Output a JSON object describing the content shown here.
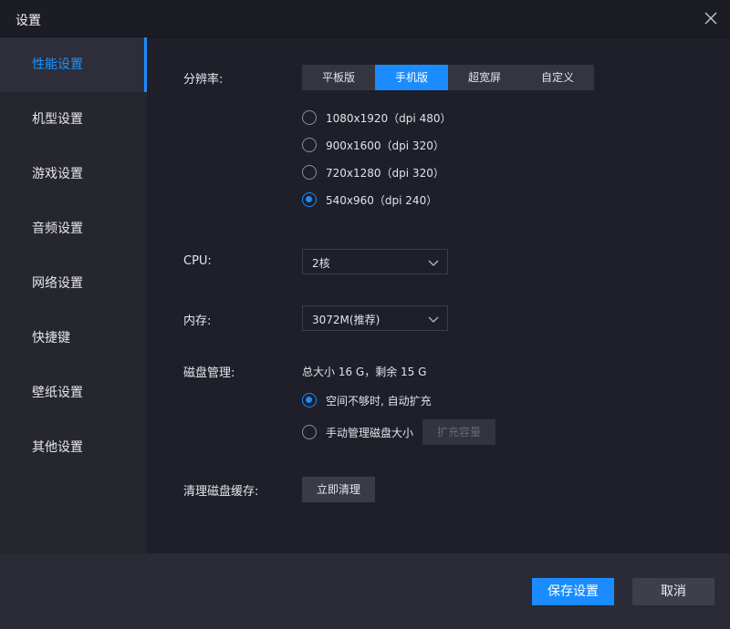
{
  "window": {
    "title": "设置"
  },
  "sidebar": {
    "items": [
      {
        "label": "性能设置"
      },
      {
        "label": "机型设置"
      },
      {
        "label": "游戏设置"
      },
      {
        "label": "音频设置"
      },
      {
        "label": "网络设置"
      },
      {
        "label": "快捷键"
      },
      {
        "label": "壁纸设置"
      },
      {
        "label": "其他设置"
      }
    ],
    "active_label": "性能设置"
  },
  "resolution": {
    "label": "分辨率:",
    "tabs": [
      {
        "label": "平板版"
      },
      {
        "label": "手机版"
      },
      {
        "label": "超宽屏"
      },
      {
        "label": "自定义"
      }
    ],
    "active_tab": "手机版",
    "options": [
      {
        "label": "1080x1920（dpi 480）"
      },
      {
        "label": "900x1600（dpi 320）"
      },
      {
        "label": "720x1280（dpi 320）"
      },
      {
        "label": "540x960（dpi 240）"
      }
    ],
    "selected_option": "540x960（dpi 240）"
  },
  "cpu": {
    "label": "CPU:",
    "value": "2核"
  },
  "memory": {
    "label": "内存:",
    "value": "3072M(推荐)"
  },
  "disk": {
    "label": "磁盘管理:",
    "info": "总大小 16 G，剩余 15 G",
    "options": [
      {
        "label": "空间不够时, 自动扩充"
      },
      {
        "label": "手动管理磁盘大小"
      }
    ],
    "selected_option": "空间不够时, 自动扩充",
    "expand_label": "扩充容量"
  },
  "cache": {
    "label": "清理磁盘缓存:",
    "button_label": "立即清理"
  },
  "footer": {
    "save_label": "保存设置",
    "cancel_label": "取消"
  },
  "colors": {
    "accent": "#1a8cff",
    "background": "#1e1f29",
    "sidebar": "#26262f"
  },
  "icons": {
    "close": "close-icon",
    "dropdown": "chevron-down-icon"
  }
}
